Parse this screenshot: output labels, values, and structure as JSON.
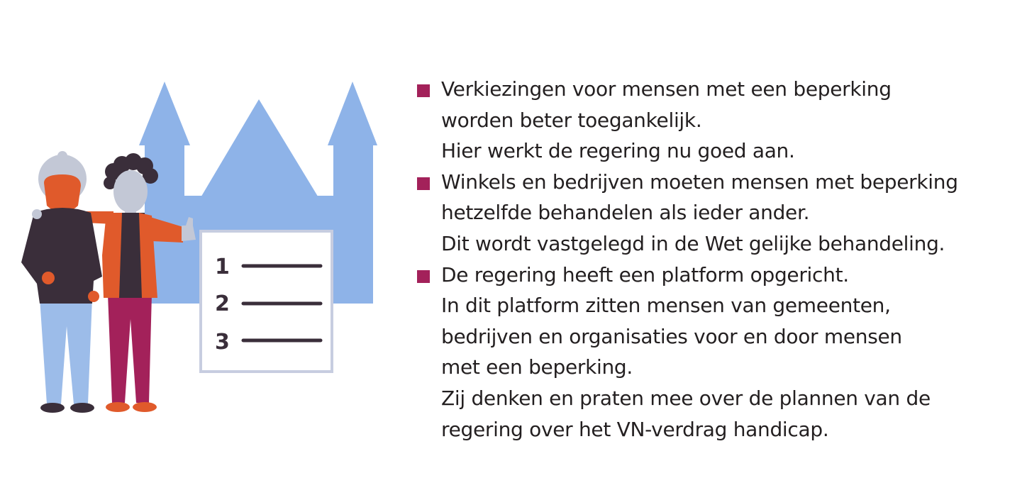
{
  "colors": {
    "accent": "#a3215a",
    "castle": "#8eb3e8",
    "orange": "#e05a2b",
    "dark": "#3a2e3a",
    "hair_grey": "#c3c8d6",
    "skin": "#c3c8d6",
    "pants_blue": "#9cbce9",
    "pants_purple": "#a3215a",
    "sheet_border": "#c7cde0"
  },
  "illustration": {
    "list_numbers": [
      "1",
      "2",
      "3"
    ]
  },
  "bullets": [
    {
      "lines": [
        "Verkiezingen voor mensen met een beperking",
        "worden beter toegankelijk.",
        "Hier werkt de regering nu goed aan."
      ]
    },
    {
      "lines": [
        "Winkels en bedrijven moeten mensen met beperking",
        "hetzelfde behandelen als ieder ander.",
        "Dit wordt vastgelegd in de Wet gelijke behandeling."
      ]
    },
    {
      "lines": [
        "De regering heeft een platform opgericht.",
        "In dit platform zitten mensen van gemeenten,",
        "bedrijven en organisaties voor en door mensen",
        "met een beperking.",
        "Zij denken en praten mee over de plannen van de",
        "regering over het VN-verdrag handicap."
      ]
    }
  ]
}
